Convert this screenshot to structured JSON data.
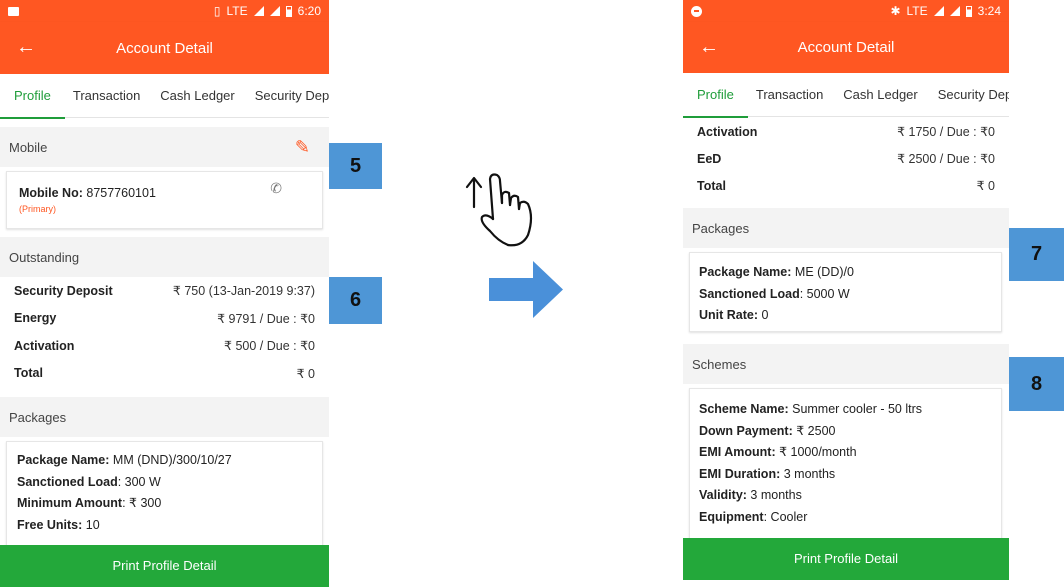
{
  "left": {
    "status": {
      "time": "6:20",
      "network": "LTE"
    },
    "appbar": {
      "title": "Account Detail"
    },
    "tabs": [
      "Profile",
      "Transaction",
      "Cash Ledger",
      "Security Dep"
    ],
    "mobile": {
      "header": "Mobile",
      "label": "Mobile No:",
      "number": "8757760101",
      "tag": "(Primary)"
    },
    "outstanding": {
      "header": "Outstanding",
      "rows": [
        {
          "k": "Security Deposit",
          "v": "₹ 750 (13-Jan-2019 9:37)"
        },
        {
          "k": "Energy",
          "v": "₹ 9791 / Due : ₹0"
        },
        {
          "k": "Activation",
          "v": "₹ 500 / Due : ₹0"
        },
        {
          "k": "Total",
          "v": "₹ 0"
        }
      ]
    },
    "packages": {
      "header": "Packages",
      "items": [
        {
          "k": "Package Name:",
          "v": "MM (DND)/300/10/27"
        },
        {
          "k": "Sanctioned Load",
          "v": ": 300 W"
        },
        {
          "k": "Minimum Amount",
          "v": ": ₹ 300"
        },
        {
          "k": "Free Units:",
          "v": "10"
        }
      ]
    },
    "button": "Print Profile Detail"
  },
  "right": {
    "status": {
      "time": "3:24",
      "network": "LTE"
    },
    "appbar": {
      "title": "Account Detail"
    },
    "tabs": [
      "Profile",
      "Transaction",
      "Cash Ledger",
      "Security Dep"
    ],
    "outstanding_rows": [
      {
        "k": "Activation",
        "v": "₹ 1750 / Due : ₹0"
      },
      {
        "k": "EeD",
        "v": "₹ 2500 / Due : ₹0"
      },
      {
        "k": "Total",
        "v": "₹ 0"
      }
    ],
    "packages": {
      "header": "Packages",
      "items": [
        {
          "k": "Package Name:",
          "v": "ME (DD)/0"
        },
        {
          "k": "Sanctioned Load",
          "v": ": 5000 W"
        },
        {
          "k": "Unit Rate:",
          "v": "0"
        }
      ]
    },
    "schemes": {
      "header": "Schemes",
      "items": [
        {
          "k": "Scheme Name:",
          "v": "Summer cooler - 50 ltrs"
        },
        {
          "k": "Down Payment:",
          "v": "₹ 2500"
        },
        {
          "k": "EMI Amount:",
          "v": "₹ 1000/month"
        },
        {
          "k": "EMI Duration:",
          "v": "3 months"
        },
        {
          "k": "Validity:",
          "v": "3 months"
        },
        {
          "k": "Equipment",
          "v": ": Cooler"
        }
      ]
    },
    "button": "Print Profile Detail"
  },
  "badges": [
    "5",
    "6",
    "7",
    "8"
  ],
  "icons": [
    "back-arrow-icon",
    "pencil-icon",
    "phone-icon",
    "swipe-up-hand-icon",
    "right-arrow-icon"
  ],
  "colors": {
    "accent": "#ff5722",
    "tab_active": "#1f9d3a",
    "button": "#23a83a",
    "badge": "#4e96d6",
    "arrow": "#4a90d9"
  }
}
